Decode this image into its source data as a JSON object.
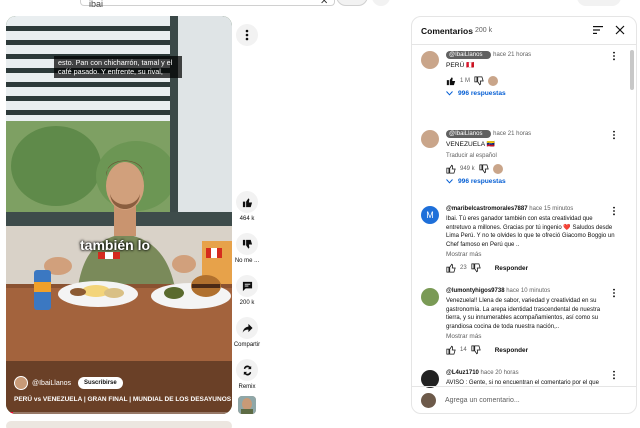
{
  "search": {
    "query": "ibai"
  },
  "video": {
    "caption_top": "esto. Pan con chicharrón, tamal y el café pasado. Y enfrente, su rival,",
    "caption_mid": "también lo",
    "channel": "@IbaiLlanos",
    "subscribe_label": "Suscribirse",
    "title": "PERÚ vs VENEZUELA | GRAN FINAL | MUNDIAL DE LOS DESAYUNOS",
    "progress_fraction": 0.03
  },
  "actions": [
    {
      "icon": "thumbs-up-icon",
      "label": "464 k"
    },
    {
      "icon": "thumbs-down-icon",
      "label": "No me ..."
    },
    {
      "icon": "comment-icon",
      "label": "200 k"
    },
    {
      "icon": "share-icon",
      "label": "Compartir"
    },
    {
      "icon": "remix-icon",
      "label": "Remix"
    }
  ],
  "comments_panel": {
    "title": "Comentarios",
    "count": "200 k",
    "input_placeholder": "Agrega un comentario...",
    "comments": [
      {
        "author": "@IbaiLlanos",
        "is_creator": true,
        "time": "hace 21 horas",
        "text": "PERÚ 🇵🇪",
        "likes": "1 M",
        "creator_heart": true,
        "replies": "996 respuestas"
      },
      {
        "author": "@IbaiLlanos",
        "is_creator": true,
        "time": "hace 21 horas",
        "text": "VENEZUELA 🇻🇪",
        "translate": "Traducir al español",
        "likes": "949 k",
        "creator_heart": true,
        "replies": "996 respuestas"
      },
      {
        "author": "@maribelcastromorales7887",
        "time": "hace 15 minutos",
        "text": "Ibai.  Tú eres ganador también con esta creatividad que entretuvo a millones.   Gracias por tú ingenio ❤️ Saludos desde Lima Perú.  Y no te olvides lo que te ofreció Giacomo Boggio un Chef famoso en Perú que ..",
        "more": "Mostrar más",
        "likes": "23",
        "reply_label": "Responder"
      },
      {
        "author": "@lumontyhigos9738",
        "time": "hace 10 minutos",
        "text": "Venezuela!! Llena de sabor, variedad y creatividad en su gastronomía. La arepa identidad trascendental de nuestra tierra, y su innumerables acompañamientos, así como su grandiosa cocina de toda nuestra nación,..",
        "more": "Mostrar más",
        "likes": "14",
        "reply_label": "Responder"
      },
      {
        "author": "@L4uz1710",
        "time": "hace 20 horas",
        "text": "AVISO : Gente, si no encuentran el comentario por el que quieran votar, en cualquier video de ibai que haya"
      }
    ]
  },
  "colors": {
    "link_blue": "#065fd4",
    "youtube_red": "#ff0033",
    "text_primary": "#0f0f0f",
    "text_secondary": "#606060"
  }
}
